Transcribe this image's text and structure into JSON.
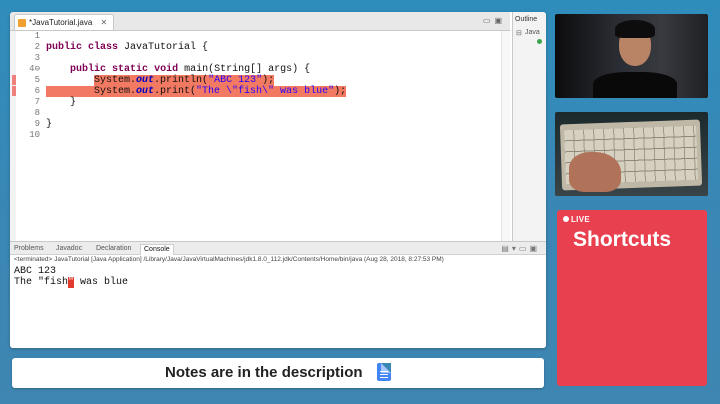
{
  "editor": {
    "tab_label": "*JavaTutorial.java",
    "line_numbers": [
      "1",
      "2",
      "3",
      "4⊖",
      "5",
      "6",
      "7",
      "8",
      "9",
      "10"
    ]
  },
  "outline": {
    "tab_label": "Outline",
    "item_text": "Java"
  },
  "console": {
    "tabs": [
      {
        "label": "Problems",
        "active": false
      },
      {
        "label": "Javadoc",
        "active": false
      },
      {
        "label": "Declaration",
        "active": false
      },
      {
        "label": "Console",
        "active": true
      }
    ],
    "status": "<terminated> JavaTutorial [Java Application] /Library/Java/JavaVirtualMachines/jdk1.8.0_112.jdk/Contents/Home/bin/java (Aug 28, 2018, 8:27:53 PM)",
    "output": [
      "ABC 123",
      "The \"fish\" was blue"
    ]
  },
  "notes": {
    "text": "Notes are in the description"
  },
  "live": {
    "tag": "LIVE",
    "title": "Shortcuts"
  },
  "icons": {
    "file": "java-file-icon",
    "doc": "google-docs-icon"
  },
  "colors": {
    "highlight": "#f27a62",
    "live_panel": "#e8404f",
    "background": "#3a86b4",
    "keyword": "#7f0055",
    "string": "#2a00ff"
  }
}
